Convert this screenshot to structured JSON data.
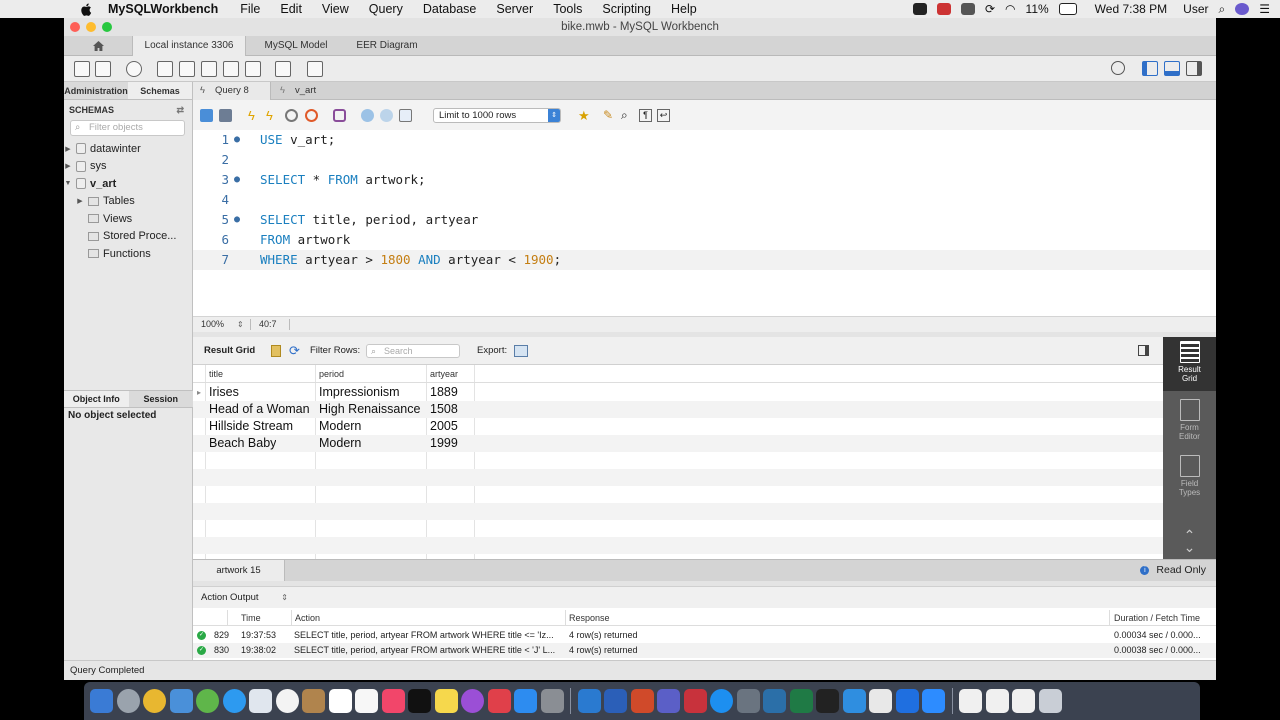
{
  "menubar": {
    "app_name": "MySQLWorkbench",
    "items": [
      "File",
      "Edit",
      "View",
      "Query",
      "Database",
      "Server",
      "Tools",
      "Scripting",
      "Help"
    ],
    "battery": "11%",
    "clock": "Wed 7:38 PM",
    "user": "User"
  },
  "window": {
    "title": "bike.mwb - MySQL Workbench"
  },
  "conn_tabs": [
    "Local instance 3306",
    "MySQL Model",
    "EER Diagram"
  ],
  "sidebar": {
    "tabs": [
      "Administration",
      "Schemas"
    ],
    "heading": "SCHEMAS",
    "filter_placeholder": "Filter objects",
    "tree": [
      "datawinter",
      "sys",
      "v_art",
      "Tables",
      "Views",
      "Stored Proce...",
      "Functions"
    ],
    "obj_tabs": [
      "Object Info",
      "Session"
    ],
    "no_object": "No object selected"
  },
  "query_tabs": [
    "Query 8",
    "v_art"
  ],
  "limit_select": "Limit to 1000 rows",
  "editor": {
    "line_numbers": [
      "1",
      "2",
      "3",
      "4",
      "5",
      "6",
      "7"
    ],
    "l1": {
      "kw": "USE",
      "rest": " v_art;"
    },
    "l3": {
      "kw1": "SELECT",
      "mid": " * ",
      "kw2": "FROM",
      "rest": " artwork;"
    },
    "l5": {
      "kw": "SELECT",
      "rest": " title, period, artyear"
    },
    "l6": {
      "kw": "FROM",
      "rest": " artwork"
    },
    "l7": {
      "kw1": "WHERE",
      "a": " artyear > ",
      "n1": "1800",
      "kw2": "AND",
      "b": " artyear < ",
      "n2": "1900",
      "c": ";"
    },
    "zoom": "100%",
    "cursor": "40:7"
  },
  "result_toolbar": {
    "result_grid": "Result Grid",
    "filter_rows": "Filter Rows:",
    "search_placeholder": "Search",
    "export": "Export:"
  },
  "grid": {
    "columns": [
      "title",
      "period",
      "artyear"
    ],
    "rows": [
      [
        "Irises",
        "Impressionism",
        "1889"
      ],
      [
        "Head of a Woman",
        "High Renaissance",
        "1508"
      ],
      [
        "Hillside Stream",
        "Modern",
        "2005"
      ],
      [
        "Beach Baby",
        "Modern",
        "1999"
      ]
    ]
  },
  "result_side": {
    "result_grid": [
      "Result",
      "Grid"
    ],
    "form_editor": [
      "Form",
      "Editor"
    ],
    "field_types": [
      "Field",
      "Types"
    ]
  },
  "result_bottom": {
    "tab": "artwork 15",
    "read_only": "Read Only"
  },
  "action_output": {
    "header": "Action Output",
    "columns": [
      "Time",
      "Action",
      "Response",
      "Duration / Fetch Time"
    ],
    "rows": [
      {
        "n": "829",
        "time": "19:37:53",
        "action": "SELECT title, period, artyear FROM artwork WHERE title <= 'Iz...",
        "response": "4 row(s) returned",
        "duration": "0.00034 sec / 0.000..."
      },
      {
        "n": "830",
        "time": "19:38:02",
        "action": "SELECT title, period, artyear FROM artwork WHERE title < 'J' L...",
        "response": "4 row(s) returned",
        "duration": "0.00038 sec / 0.000..."
      }
    ]
  },
  "status": "Query Completed"
}
